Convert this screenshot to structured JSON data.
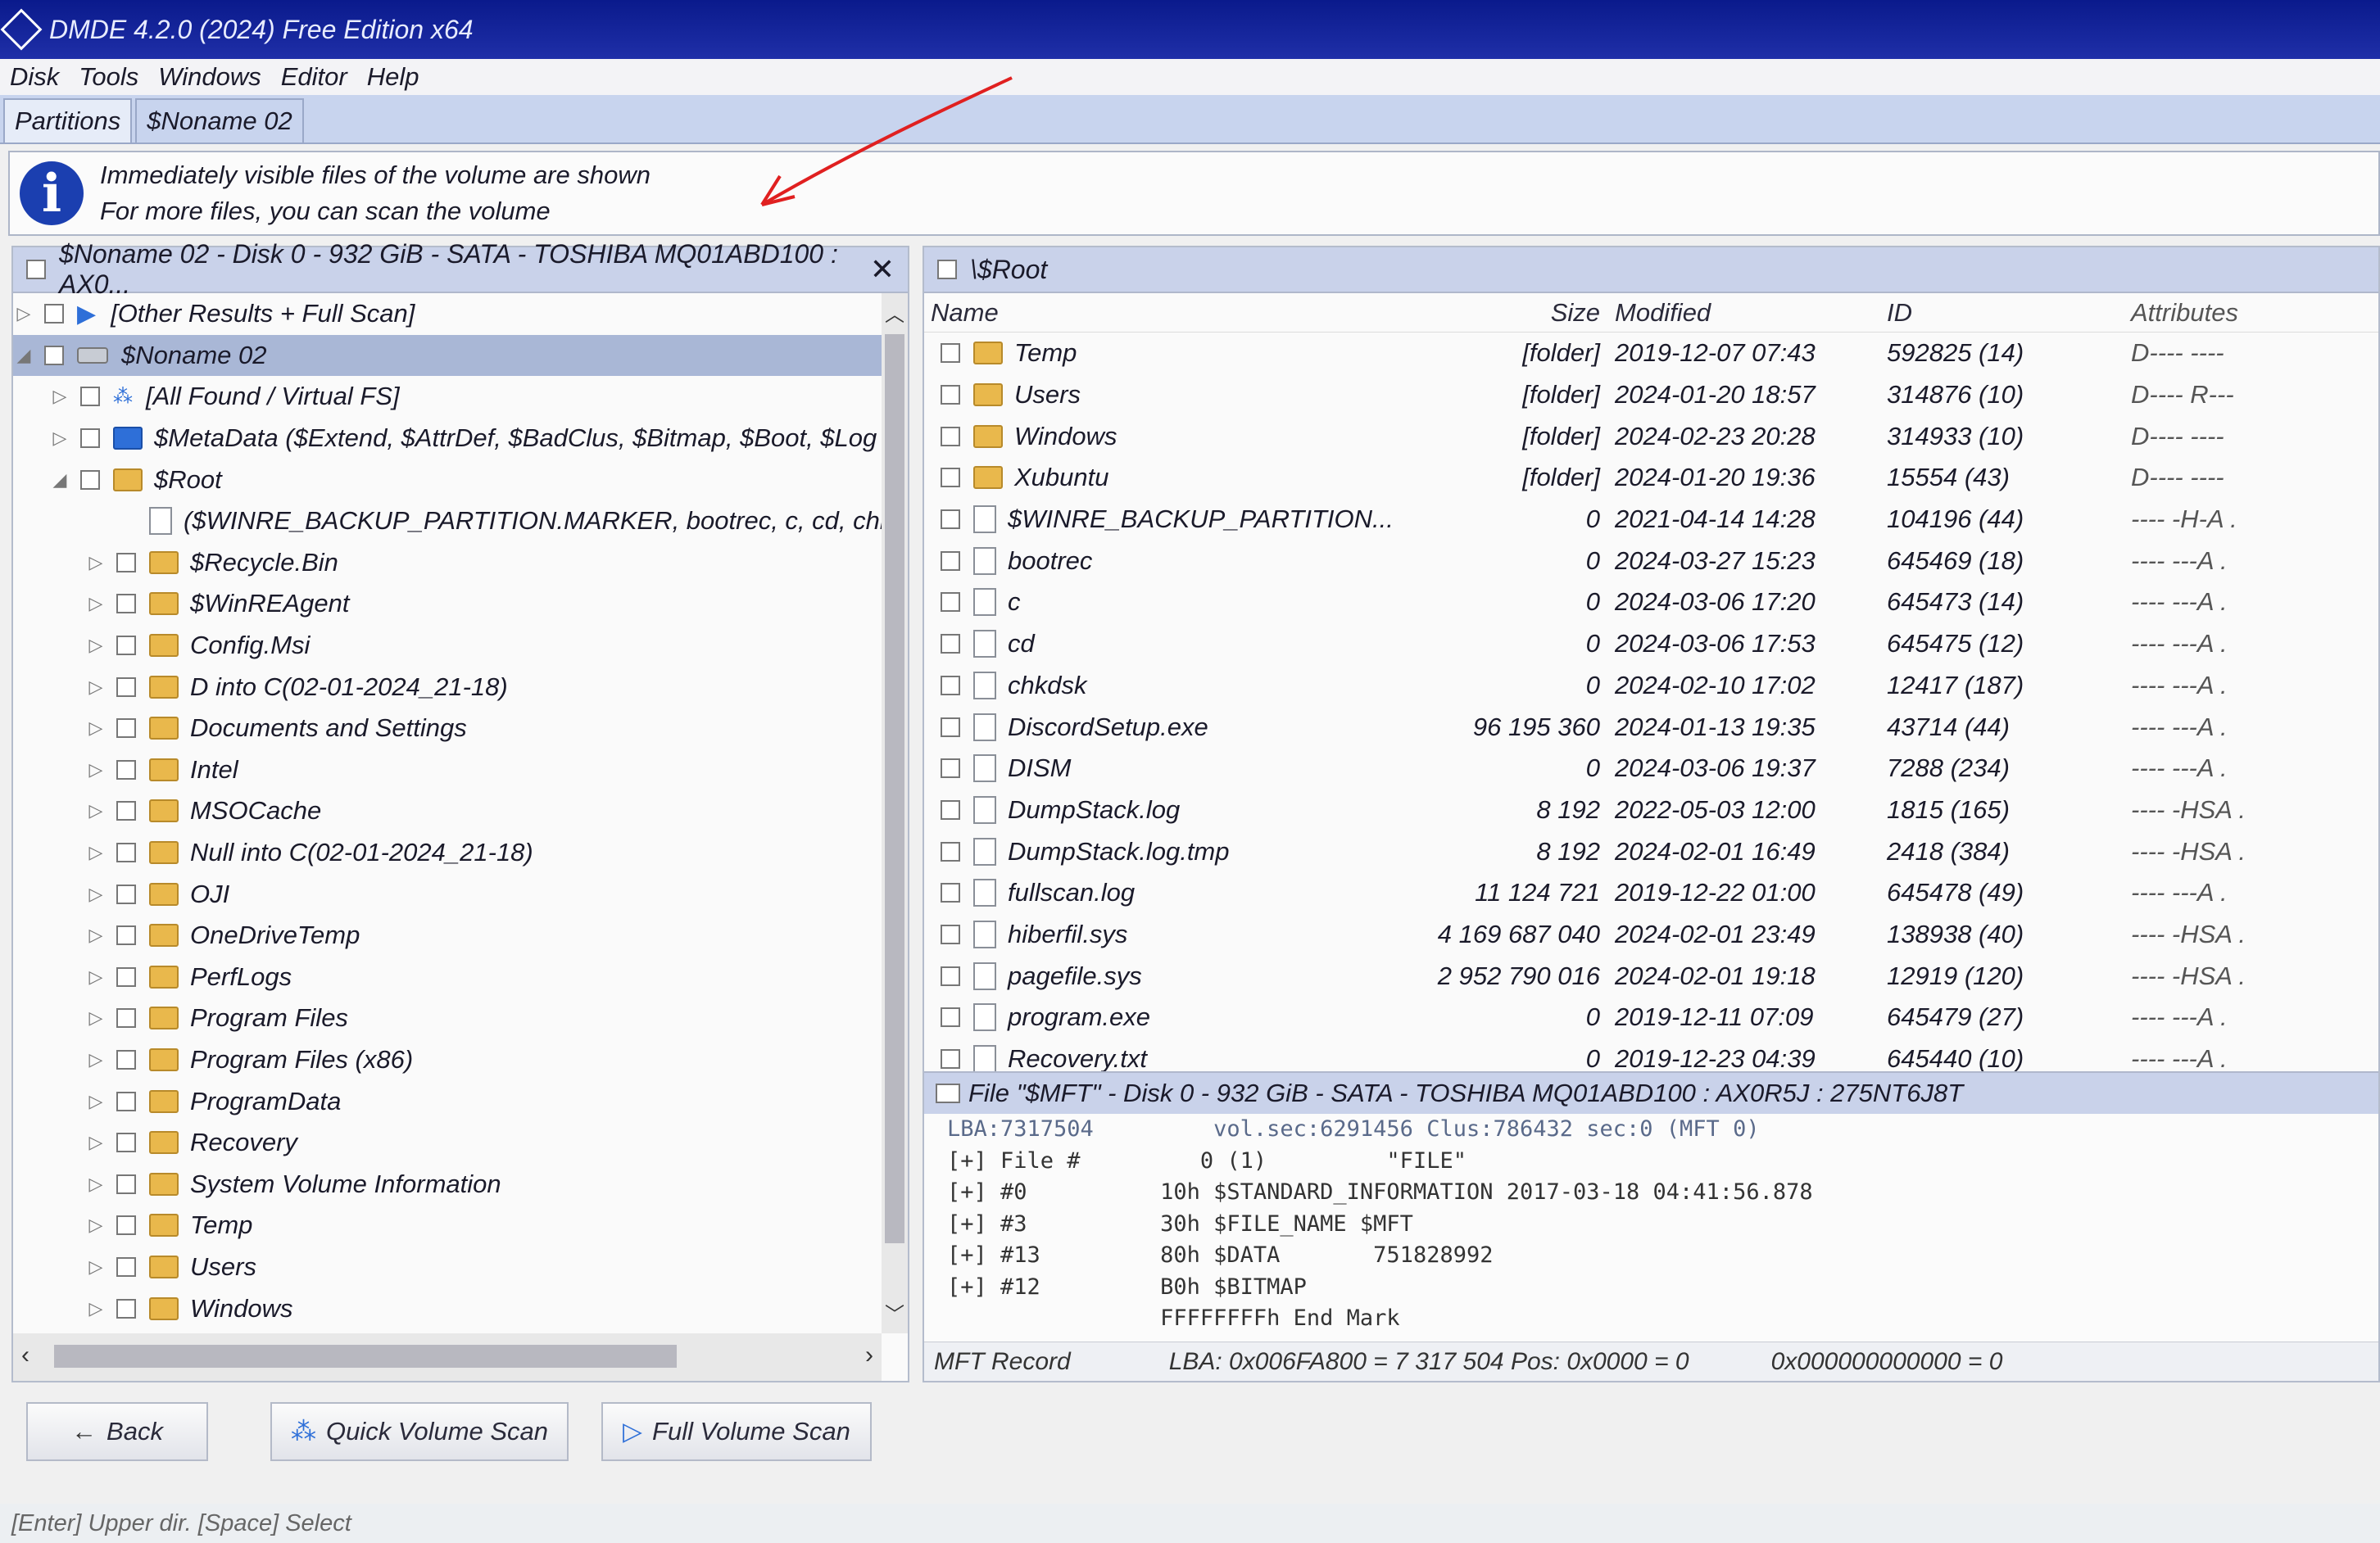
{
  "app": {
    "title": "DMDE 4.2.0 (2024) Free Edition x64"
  },
  "menu": [
    "Disk",
    "Tools",
    "Windows",
    "Editor",
    "Help"
  ],
  "tabs": [
    {
      "label": "Partitions",
      "active": true
    },
    {
      "label": "$Noname 02",
      "active": false
    }
  ],
  "info": {
    "line1": "Immediately visible files of the volume are shown",
    "line2": "For more files, you can scan the volume"
  },
  "left_panel": {
    "header": "$Noname 02 - Disk 0 - 932 GiB - SATA - TOSHIBA MQ01ABD100 : AX0...",
    "rows": [
      {
        "label": "[Other Results + Full Scan]",
        "expander": "▷",
        "icon": "play-icon"
      },
      {
        "label": "$Noname 02",
        "expander": "◢",
        "icon": "drive-icon",
        "selected": true
      },
      {
        "label": "[All Found / Virtual FS]",
        "expander": "▷",
        "icon": "virtual-fs-icon"
      },
      {
        "label": "$MetaData ($Extend, $AttrDef, $BadClus, $Bitmap, $Boot, $Log",
        "expander": "▷",
        "icon": "folder-blue-icon"
      },
      {
        "label": "$Root",
        "expander": "◢",
        "icon": "folder-icon"
      },
      {
        "label": "($WINRE_BACKUP_PARTITION.MARKER, bootrec, c, cd, chkdsk",
        "expander": "",
        "icon": "file-icon"
      },
      {
        "label": "$Recycle.Bin",
        "expander": "▷",
        "icon": "folder-icon"
      },
      {
        "label": "$WinREAgent",
        "expander": "▷",
        "icon": "folder-icon"
      },
      {
        "label": "Config.Msi",
        "expander": "▷",
        "icon": "folder-icon"
      },
      {
        "label": "D into C(02-01-2024_21-18)",
        "expander": "▷",
        "icon": "folder-icon"
      },
      {
        "label": "Documents and Settings",
        "expander": "▷",
        "icon": "folder-icon"
      },
      {
        "label": "Intel",
        "expander": "▷",
        "icon": "folder-icon"
      },
      {
        "label": "MSOCache",
        "expander": "▷",
        "icon": "folder-icon"
      },
      {
        "label": "Null into C(02-01-2024_21-18)",
        "expander": "▷",
        "icon": "folder-icon"
      },
      {
        "label": "OJI",
        "expander": "▷",
        "icon": "folder-icon"
      },
      {
        "label": "OneDriveTemp",
        "expander": "▷",
        "icon": "folder-icon"
      },
      {
        "label": "PerfLogs",
        "expander": "▷",
        "icon": "folder-icon"
      },
      {
        "label": "Program Files",
        "expander": "▷",
        "icon": "folder-icon"
      },
      {
        "label": "Program Files (x86)",
        "expander": "▷",
        "icon": "folder-icon"
      },
      {
        "label": "ProgramData",
        "expander": "▷",
        "icon": "folder-icon"
      },
      {
        "label": "Recovery",
        "expander": "▷",
        "icon": "folder-icon"
      },
      {
        "label": "System Volume Information",
        "expander": "▷",
        "icon": "folder-icon"
      },
      {
        "label": "Temp",
        "expander": "▷",
        "icon": "folder-icon"
      },
      {
        "label": "Users",
        "expander": "▷",
        "icon": "folder-icon"
      },
      {
        "label": "Windows",
        "expander": "▷",
        "icon": "folder-icon"
      }
    ]
  },
  "right_panel": {
    "header": "\\$Root",
    "columns": {
      "name": "Name",
      "size": "Size",
      "modified": "Modified",
      "id": "ID",
      "attributes": "Attributes"
    },
    "files": [
      {
        "name": "Temp",
        "size": "[folder]",
        "modified": "2019-12-07 07:43",
        "id": "592825 (14)",
        "attr": "D---- ----",
        "folder": true
      },
      {
        "name": "Users",
        "size": "[folder]",
        "modified": "2024-01-20 18:57",
        "id": "314876 (10)",
        "attr": "D---- R---",
        "folder": true
      },
      {
        "name": "Windows",
        "size": "[folder]",
        "modified": "2024-02-23 20:28",
        "id": "314933 (10)",
        "attr": "D---- ----",
        "folder": true
      },
      {
        "name": "Xubuntu",
        "size": "[folder]",
        "modified": "2024-01-20 19:36",
        "id": "15554 (43)",
        "attr": "D---- ----",
        "folder": true
      },
      {
        "name": "$WINRE_BACKUP_PARTITION...",
        "size": "0",
        "modified": "2021-04-14 14:28",
        "id": "104196 (44)",
        "attr": "---- -H-A .",
        "folder": false
      },
      {
        "name": "bootrec",
        "size": "0",
        "modified": "2024-03-27 15:23",
        "id": "645469 (18)",
        "attr": "---- ---A .",
        "folder": false
      },
      {
        "name": "c",
        "size": "0",
        "modified": "2024-03-06 17:20",
        "id": "645473 (14)",
        "attr": "---- ---A .",
        "folder": false
      },
      {
        "name": "cd",
        "size": "0",
        "modified": "2024-03-06 17:53",
        "id": "645475 (12)",
        "attr": "---- ---A .",
        "folder": false
      },
      {
        "name": "chkdsk",
        "size": "0",
        "modified": "2024-02-10 17:02",
        "id": "12417 (187)",
        "attr": "---- ---A .",
        "folder": false
      },
      {
        "name": "DiscordSetup.exe",
        "size": "96 195 360",
        "modified": "2024-01-13 19:35",
        "id": "43714 (44)",
        "attr": "---- ---A .",
        "folder": false
      },
      {
        "name": "DISM",
        "size": "0",
        "modified": "2024-03-06 19:37",
        "id": "7288 (234)",
        "attr": "---- ---A .",
        "folder": false
      },
      {
        "name": "DumpStack.log",
        "size": "8 192",
        "modified": "2022-05-03 12:00",
        "id": "1815 (165)",
        "attr": "---- -HSA .",
        "folder": false
      },
      {
        "name": "DumpStack.log.tmp",
        "size": "8 192",
        "modified": "2024-02-01 16:49",
        "id": "2418 (384)",
        "attr": "---- -HSA .",
        "folder": false
      },
      {
        "name": "fullscan.log",
        "size": "11 124 721",
        "modified": "2019-12-22 01:00",
        "id": "645478 (49)",
        "attr": "---- ---A .",
        "folder": false
      },
      {
        "name": "hiberfil.sys",
        "size": "4 169 687 040",
        "modified": "2024-02-01 23:49",
        "id": "138938 (40)",
        "attr": "---- -HSA .",
        "folder": false
      },
      {
        "name": "pagefile.sys",
        "size": "2 952 790 016",
        "modified": "2024-02-01 19:18",
        "id": "12919 (120)",
        "attr": "---- -HSA .",
        "folder": false
      },
      {
        "name": "program.exe",
        "size": "0",
        "modified": "2019-12-11 07:09",
        "id": "645479 (27)",
        "attr": "---- ---A .",
        "folder": false
      },
      {
        "name": "Recovery.txt",
        "size": "0",
        "modified": "2019-12-23 04:39",
        "id": "645440 (10)",
        "attr": "---- ---A .",
        "folder": false
      }
    ]
  },
  "mft": {
    "header": "File \"$MFT\" - Disk 0 - 932 GiB - SATA - TOSHIBA MQ01ABD100 : AX0R5J : 275NT6J8T",
    "lines": [
      "LBA:7317504         vol.sec:6291456 Clus:786432 sec:0 (MFT 0)",
      "[+] File #         0 (1)         \"FILE\"",
      "[+] #0          10h $STANDARD_INFORMATION 2017-03-18 04:41:56.878",
      "[+] #3          30h $FILE_NAME $MFT",
      "[+] #13         80h $DATA       751828992",
      "[+] #12         B0h $BITMAP",
      "                FFFFFFFFh End Mark"
    ],
    "status_label": "MFT Record",
    "status_lba": "LBA: 0x006FA800 = 7 317 504  Pos: 0x0000 = 0",
    "status_val": "0x000000000000 = 0"
  },
  "buttons": {
    "back": "Back",
    "quick": "Quick Volume Scan",
    "full": "Full Volume Scan"
  },
  "statusbar": "[Enter] Upper dir.  [Space] Select"
}
